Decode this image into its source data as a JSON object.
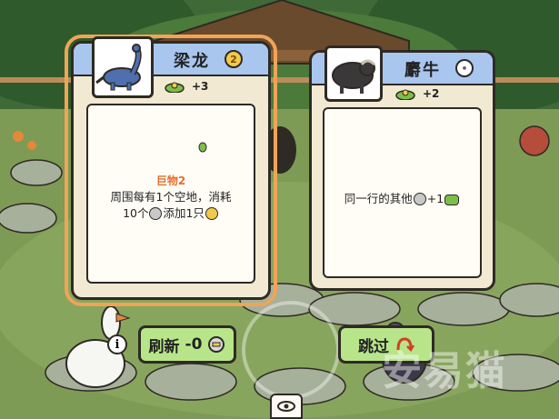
{
  "cards": [
    {
      "name": "梁龙",
      "rarity_icon": "gold-rarity-icon",
      "value": "+3",
      "ability_title": "巨物2",
      "ability_line1": "周围每有1个空地，消耗",
      "ability_line2_a": "10个",
      "ability_line2_b": "添加1只",
      "selected": true
    },
    {
      "name": "麝牛",
      "rarity_icon": "white-rarity-icon",
      "value": "+2",
      "ability_a": "同一行的其他",
      "ability_b": "+1",
      "selected": false
    }
  ],
  "buttons": {
    "refresh_label": "刷新",
    "refresh_cost": "-0",
    "skip_label": "跳过"
  },
  "watermark": "安易猫",
  "colors": {
    "card_header": "#a9c6ee",
    "card_bg": "#f1e9d2",
    "button_green": "#b8e58a",
    "selected_outline": "#f0a458",
    "ability_title": "#e2702f"
  }
}
